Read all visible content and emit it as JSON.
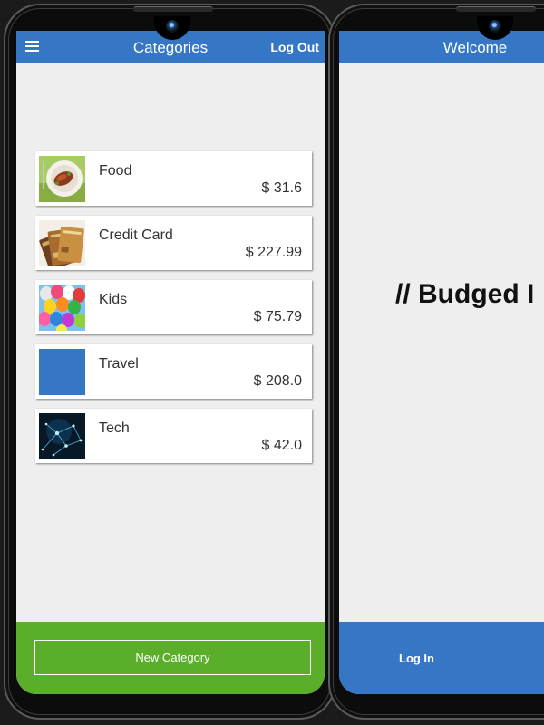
{
  "left_phone": {
    "header": {
      "title": "Categories",
      "logout_label": "Log Out"
    },
    "categories": [
      {
        "name": "Food",
        "amount": "$ 31.6",
        "thumbnail": "food-image"
      },
      {
        "name": "Credit Card",
        "amount": "$ 227.99",
        "thumbnail": "credit-card-image"
      },
      {
        "name": "Kids",
        "amount": "$ 75.79",
        "thumbnail": "balloons-image"
      },
      {
        "name": "Travel",
        "amount": "$ 208.0",
        "thumbnail": "blue-square"
      },
      {
        "name": "Tech",
        "amount": "$ 42.0",
        "thumbnail": "tech-network-image"
      }
    ],
    "footer": {
      "new_category_label": "New Category"
    }
  },
  "right_phone": {
    "header": {
      "title": "Welcome"
    },
    "heading": "// Budged I",
    "footer": {
      "login_label": "Log In"
    }
  },
  "colors": {
    "header_blue": "#3677c5",
    "footer_green": "#5aae2a",
    "screen_background": "#eeeeee",
    "travel_thumbnail": "#3677c5"
  }
}
